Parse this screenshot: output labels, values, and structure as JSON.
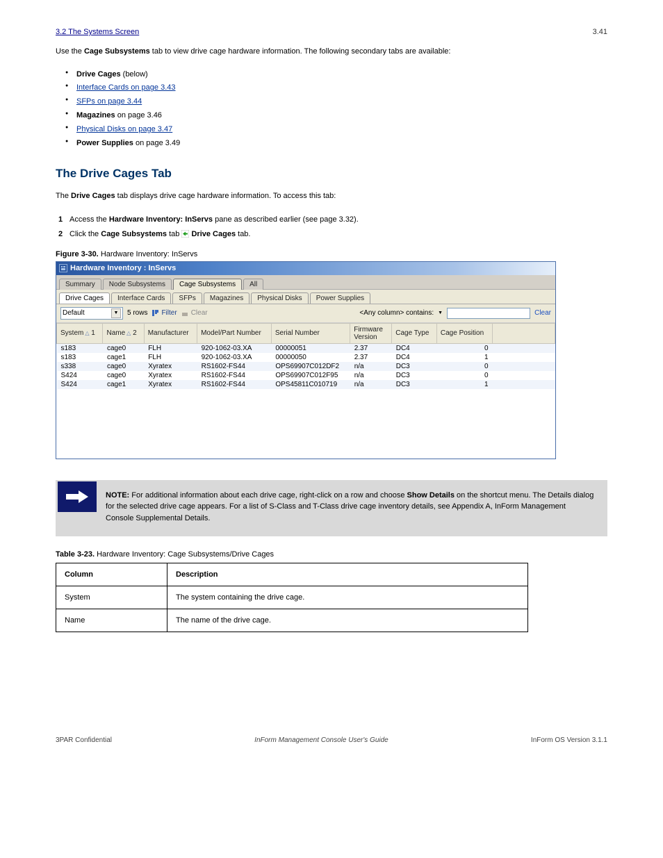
{
  "header": {
    "breadcrumb": "3.2 The Systems Screen",
    "page_top": "3.41"
  },
  "intro": {
    "text_before": "Use the ",
    "bold1": "Cage Subsystems",
    "text_after": " tab to view drive cage hardware information. The following secondary tabs are available:"
  },
  "bullets": [
    {
      "label": "Drive Cages",
      "rest": " (below)"
    },
    {
      "label": "Interface Cards",
      "rest": " on page 3.43",
      "link": true
    },
    {
      "label": "SFPs",
      "rest": " on page 3.44",
      "link": true
    },
    {
      "label": "Magazines",
      "rest": " on page 3.46"
    },
    {
      "label": "Physical Disks",
      "rest": " on page 3.47",
      "link": true
    },
    {
      "label": "Power Supplies",
      "rest": " on page 3.49"
    }
  ],
  "heading": "The Drive Cages Tab",
  "para_under_h2": {
    "pre": "The ",
    "bold1": "Drive Cages",
    "post": " tab displays drive cage hardware information. To access this tab:"
  },
  "steps": {
    "step1": {
      "pre": "Access the ",
      "bold": "Hardware Inventory: InServs",
      "post": " pane as described earlier (see page 3.32)."
    },
    "step2": {
      "pre": "Click the ",
      "b1": "Cage Subsystems",
      "mid": " tab ",
      "b2": "Drive Cages",
      "post": " tab."
    }
  },
  "figure_caption": {
    "label": "Figure 3-30.",
    "text": "Hardware Inventory: InServs"
  },
  "window": {
    "title": "Hardware Inventory : InServs",
    "tabs": [
      "Summary",
      "Node Subsystems",
      "Cage Subsystems",
      "All"
    ],
    "active_tab": 2,
    "subtabs": [
      "Drive Cages",
      "Interface Cards",
      "SFPs",
      "Magazines",
      "Physical Disks",
      "Power Supplies"
    ],
    "active_subtab": 0,
    "toolbar": {
      "dropdown_value": "Default",
      "row_count": "5 rows",
      "filter": "Filter",
      "clear": "Clear",
      "match_label": "<Any column> contains:",
      "clear_right": "Clear"
    },
    "columns": [
      "System",
      "Name",
      "Manufacturer",
      "Model/Part Number",
      "Serial Number",
      "Firmware Version",
      "Cage Type",
      "Cage Position"
    ],
    "sort": {
      "col0": "1",
      "col1": "2"
    },
    "rows": [
      {
        "System": "s183",
        "Name": "cage0",
        "Manufacturer": "FLH",
        "Model": "920-1062-03.XA",
        "Serial": "00000051",
        "Firmware": "2.37",
        "CageType": "DC4",
        "CagePos": "0"
      },
      {
        "System": "s183",
        "Name": "cage1",
        "Manufacturer": "FLH",
        "Model": "920-1062-03.XA",
        "Serial": "00000050",
        "Firmware": "2.37",
        "CageType": "DC4",
        "CagePos": "1"
      },
      {
        "System": "s338",
        "Name": "cage0",
        "Manufacturer": "Xyratex",
        "Model": "RS1602-FS44",
        "Serial": "OPS69907C012DF2",
        "Firmware": "n/a",
        "CageType": "DC3",
        "CagePos": "0"
      },
      {
        "System": "S424",
        "Name": "cage0",
        "Manufacturer": "Xyratex",
        "Model": "RS1602-FS44",
        "Serial": "OPS69907C012F95",
        "Firmware": "n/a",
        "CageType": "DC3",
        "CagePos": "0"
      },
      {
        "System": "S424",
        "Name": "cage1",
        "Manufacturer": "Xyratex",
        "Model": "RS1602-FS44",
        "Serial": "OPS45811C010719",
        "Firmware": "n/a",
        "CageType": "DC3",
        "CagePos": "1"
      }
    ]
  },
  "note": {
    "label": "NOTE:",
    "body_pre": " For additional information about each drive cage, right-click on a row and choose ",
    "bold1": "Show Details",
    "body_mid": " on the shortcut menu. The Details dialog for the selected drive cage appears. For a list of S-Class and T-Class drive cage inventory details, see Appendix A, ",
    "link": "InForm Management Console Supplemental Details",
    "body_post": "."
  },
  "inv_table": {
    "label": "Table 3-23.",
    "title": "Hardware Inventory: Cage Subsystems/Drive Cages",
    "headers": [
      "Column",
      "Description"
    ],
    "rows": [
      [
        "System",
        "The system containing the drive cage."
      ],
      [
        "Name",
        "The name of the drive cage."
      ]
    ]
  },
  "footer": {
    "left": "3PAR Confidential",
    "mid": "InForm Management Console User's Guide",
    "right": "InForm OS Version 3.1.1"
  }
}
